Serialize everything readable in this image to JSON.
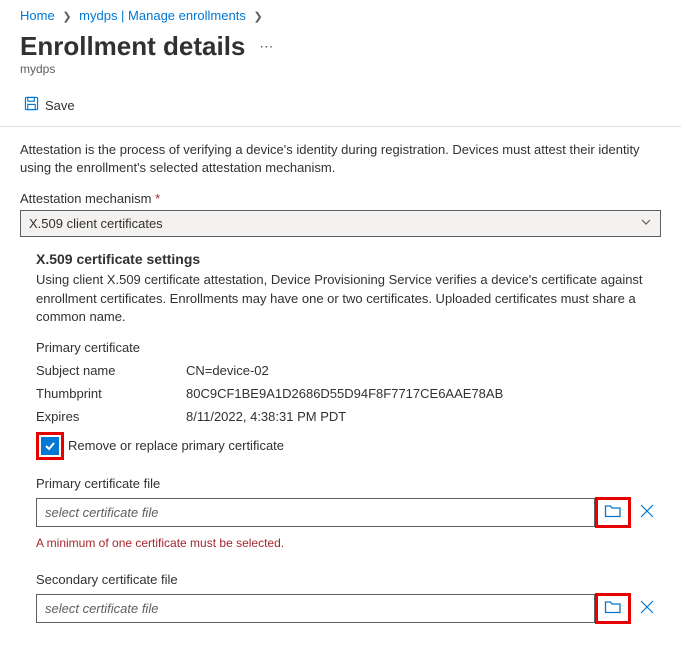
{
  "breadcrumb": {
    "home": "Home",
    "manage": "mydps | Manage enrollments"
  },
  "header": {
    "title": "Enrollment details",
    "subtitle": "mydps"
  },
  "toolbar": {
    "save_label": "Save"
  },
  "intro": "Attestation is the process of verifying a device's identity during registration. Devices must attest their identity using the enrollment's selected attestation mechanism.",
  "attestation": {
    "label": "Attestation mechanism",
    "value": "X.509 client certificates"
  },
  "settings": {
    "heading": "X.509 certificate settings",
    "description": "Using client X.509 certificate attestation, Device Provisioning Service verifies a device's certificate against enrollment certificates. Enrollments may have one or two certificates. Uploaded certificates must share a common name.",
    "primary_label": "Primary certificate",
    "subject_label": "Subject name",
    "subject_value": "CN=device-02",
    "thumbprint_label": "Thumbprint",
    "thumbprint_value": "80C9CF1BE9A1D2686D55D94F8F7717CE6AAE78AB",
    "expires_label": "Expires",
    "expires_value": "8/11/2022, 4:38:31 PM PDT",
    "remove_label": "Remove or replace primary certificate",
    "primary_file_label": "Primary certificate file",
    "primary_file_placeholder": "select certificate file",
    "error": "A minimum of one certificate must be selected.",
    "secondary_file_label": "Secondary certificate file",
    "secondary_file_placeholder": "select certificate file"
  }
}
